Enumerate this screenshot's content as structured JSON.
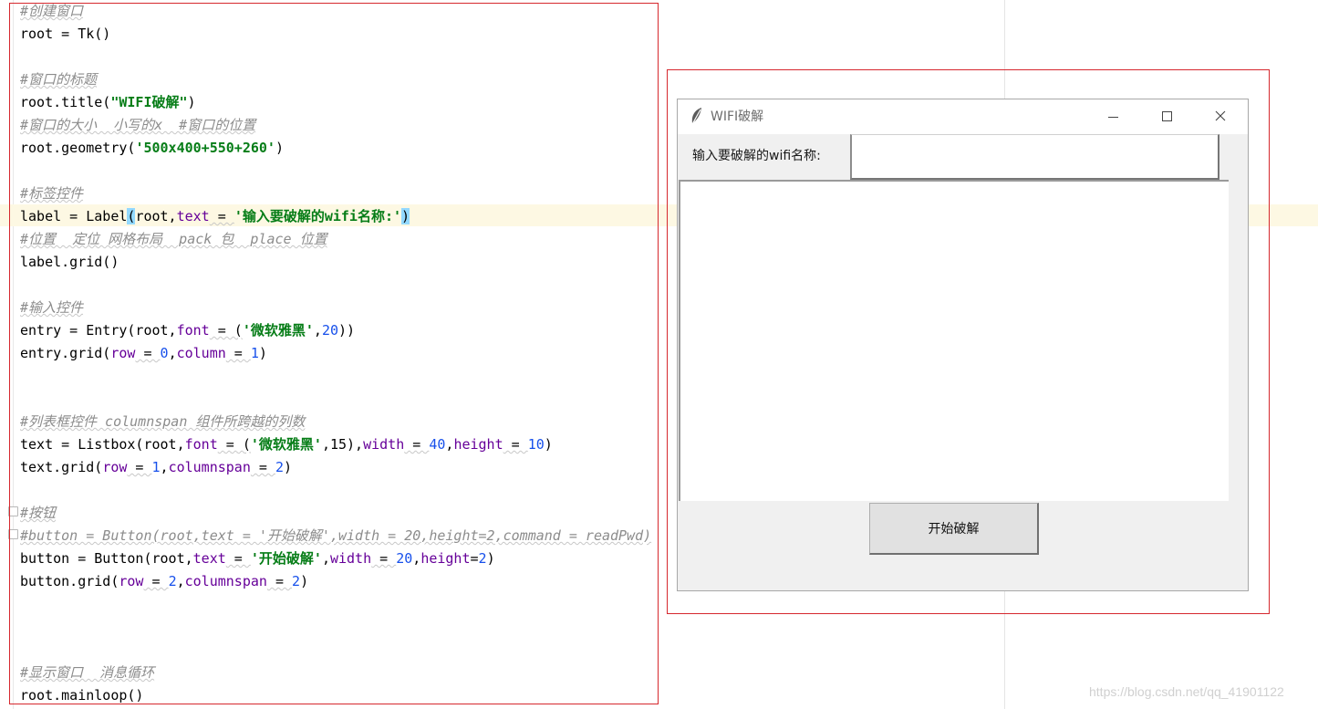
{
  "editor": {
    "lines": {
      "l1": "#创建窗口",
      "l2": "root = Tk()",
      "l4": "#窗口的标题",
      "l5a": "root.title(",
      "l5b": "\"WIFI破解\"",
      "l5c": ")",
      "l6": "#窗口的大小  小写的x  #窗口的位置",
      "l7a": "root.geometry(",
      "l7b": "'500x400+550+260'",
      "l7c": ")",
      "l9": "#标签控件",
      "l10a": "label = Label",
      "l10b": "(",
      "l10c": "root,",
      "l10d": "text",
      "l10e": " = ",
      "l10f": "'输入要破解的wifi名称:'",
      "l10g": ")",
      "l11": "#位置  定位 网格布局  pack 包  place 位置",
      "l12": "label.grid()",
      "l14": "#输入控件",
      "l15a": "entry = Entry(root,",
      "l15b": "font",
      "l15c": " = (",
      "l15d": "'微软雅黑'",
      "l15e": ",",
      "l15f": "20",
      "l15g": "))",
      "l16a": "entry.grid(",
      "l16b": "row",
      "l16c": " = ",
      "l16d": "0",
      "l16e": ",",
      "l16f": "column",
      "l16g": " = ",
      "l16h": "1",
      "l16i": ")",
      "l19": "#列表框控件 columnspan 组件所跨越的列数",
      "l20a": "text = Listbox(root,",
      "l20b": "font",
      "l20c": " = (",
      "l20d": "'微软雅黑'",
      "l20e": ",",
      "l20f": "15",
      "l20g": "),",
      "l20h": "width",
      "l20i": " = ",
      "l20j": "40",
      "l20k": ",",
      "l20l": "height",
      "l20m": " = ",
      "l20n": "10",
      "l20o": ")",
      "l21a": "text.grid(",
      "l21b": "row",
      "l21c": " = ",
      "l21d": "1",
      "l21e": ",",
      "l21f": "columnspan",
      "l21g": " = ",
      "l21h": "2",
      "l21i": ")",
      "l23": "#按钮",
      "l24": "#button = Button(root,text = '开始破解',width = 20,height=2,command = readPwd)",
      "l25a": "button = Button(root,",
      "l25b": "text",
      "l25c": " = ",
      "l25d": "'开始破解'",
      "l25e": ",",
      "l25f": "width",
      "l25g": " = ",
      "l25h": "20",
      "l25i": ",",
      "l25j": "height",
      "l25k": "=",
      "l25l": "2",
      "l25m": ")",
      "l26a": "button.grid(",
      "l26b": "row",
      "l26c": " = ",
      "l26d": "2",
      "l26e": ",",
      "l26f": "columnspan",
      "l26g": " = ",
      "l26h": "2",
      "l26i": ")",
      "l30": "#显示窗口  消息循环",
      "l31": "root.mainloop()"
    },
    "colors": {
      "comment": "#8c8c8c",
      "string": "#067d17",
      "keyword_arg": "#660099",
      "number": "#1750eb",
      "highlight_frame": "#d6282e"
    }
  },
  "app_window": {
    "title": "WIFI破解",
    "icon": "feather-icon",
    "label_text": "输入要破解的wifi名称:",
    "entry_value": "",
    "button_label": "开始破解",
    "controls": {
      "minimize": "minimize-icon",
      "maximize": "maximize-icon",
      "close": "close-icon"
    }
  },
  "watermark": "https://blog.csdn.net/qq_41901122"
}
